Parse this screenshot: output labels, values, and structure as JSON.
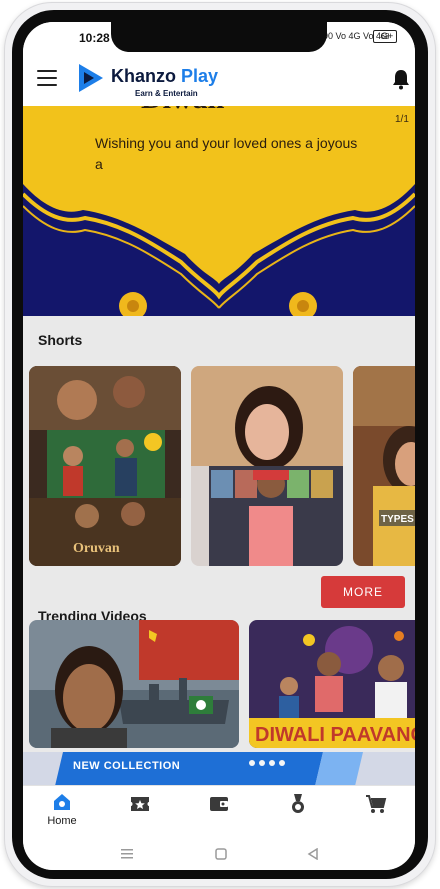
{
  "status_bar": {
    "time": "10:28",
    "indicators": "90  Vo  4G  Vo  4G+",
    "battery": "68"
  },
  "header": {
    "brand_first": "Khanzo",
    "brand_second": "Play",
    "tagline": "Earn & Entertain",
    "icons": [
      "menu-icon",
      "play-logo-icon",
      "bell-icon"
    ]
  },
  "banner": {
    "headline_partial": "Diwali",
    "message": "Wishing you and your loved ones a joyous a",
    "counter": "1/1"
  },
  "shorts": {
    "title": "Shorts",
    "cards": [
      {
        "overlay_text": "Oruvan",
        "overlay_subtext": "Oruvan"
      },
      {
        "overlay_text": ""
      },
      {
        "overlay_text": "TYPES"
      }
    ]
  },
  "trending": {
    "title": "Trending Videos",
    "more_label": "MORE",
    "cards": [
      {
        "overlay_text": ""
      },
      {
        "overlay_text": "DIWALI PAAVANG"
      }
    ]
  },
  "promo": {
    "label": "NEW COLLECTION"
  },
  "bottom_nav": {
    "items": [
      {
        "label": "Home",
        "icon": "home-icon",
        "active": true
      },
      {
        "label": "",
        "icon": "ticket-star-icon"
      },
      {
        "label": "",
        "icon": "wallet-icon"
      },
      {
        "label": "",
        "icon": "medal-icon"
      },
      {
        "label": "",
        "icon": "cart-icon"
      }
    ]
  },
  "system_nav": {
    "icons": [
      "recent-apps-icon",
      "home-square-icon",
      "back-triangle-icon"
    ]
  },
  "colors": {
    "brand_blue": "#1d7ee8",
    "brand_dark": "#0c1a3e",
    "more_button": "#d63a3a",
    "banner_gold": "#f2c21b",
    "banner_navy": "#13166b"
  }
}
